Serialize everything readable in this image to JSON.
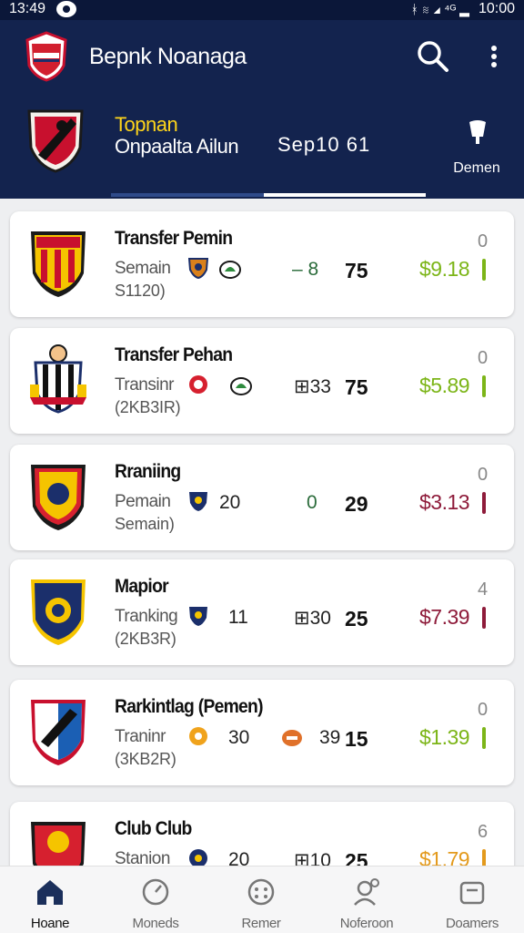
{
  "status": {
    "time": "13:49",
    "right_icons": "ᚼ ≋ ◢ ⁴ᴳ ▂",
    "clock": "10:00"
  },
  "header": {
    "app_title": "Bepnk Noanaga",
    "team_name": "Topnan",
    "team_sub": "Onpaalta Ailun",
    "season": "Sep10 61",
    "pin_label": "Demen"
  },
  "cards": [
    {
      "title": "Transfer Pemin",
      "sub1": "Semain",
      "sub2": "S1120)",
      "s1": "",
      "s2": "– 8",
      "s3": "75",
      "price": "$9.18",
      "corner": "0",
      "price_color": "#7cb518",
      "icon1": "shield-badge-icon",
      "icon2": "leaf-badge-icon"
    },
    {
      "title": "Transfer Pehan",
      "sub1": "Transinr",
      "sub2": "(2KB3IR)",
      "s1": "",
      "s2": "⊞33",
      "s3": "75",
      "price": "$5.89",
      "corner": "0",
      "price_color": "#7cb518",
      "icon1": "red-badge-icon",
      "icon2": "leaf-badge-icon"
    },
    {
      "title": "Rraniing",
      "sub1": "Pemain",
      "sub2": "Semain)",
      "s1": "20",
      "s2": "0",
      "s3": "29",
      "price": "$3.13",
      "corner": "0",
      "price_color": "#8e1b3a",
      "icon1": "navy-badge-icon",
      "icon2": ""
    },
    {
      "title": "Mapior",
      "sub1": "Tranking",
      "sub2": "(2KB3R)",
      "s1": "11",
      "s2": "⊞30",
      "s3": "25",
      "price": "$7.39",
      "corner": "4",
      "price_color": "#8e1b3a",
      "icon1": "navy-badge-icon",
      "icon2": ""
    },
    {
      "title": "Rarkintlag (Pemen)",
      "sub1": "Traninr",
      "sub2": "(3KB2R)",
      "s1": "30",
      "s2": "39",
      "s3": "15",
      "price": "$1.39",
      "corner": "0",
      "price_color": "#7cb518",
      "icon1": "orange-badge-icon",
      "icon2": "orange-badge-icon"
    },
    {
      "title": "Club Club",
      "sub1": "Stanion",
      "sub2": "",
      "s1": "20",
      "s2": "⊞10",
      "s3": "25",
      "price": "$1.79",
      "corner": "6",
      "price_color": "#e39a1c",
      "icon1": "navy-badge-icon",
      "icon2": ""
    }
  ],
  "nav": [
    {
      "label": "Hoane",
      "icon": "home-icon"
    },
    {
      "label": "Moneds",
      "icon": "clock-icon"
    },
    {
      "label": "Remer",
      "icon": "smiley-icon"
    },
    {
      "label": "Noferoon",
      "icon": "profile-icon"
    },
    {
      "label": "Doamers",
      "icon": "box-icon"
    }
  ],
  "colors": {
    "header": "#13234e",
    "accent_yellow": "#ffd51a",
    "green": "#7cb518",
    "maroon": "#8e1b3a"
  }
}
